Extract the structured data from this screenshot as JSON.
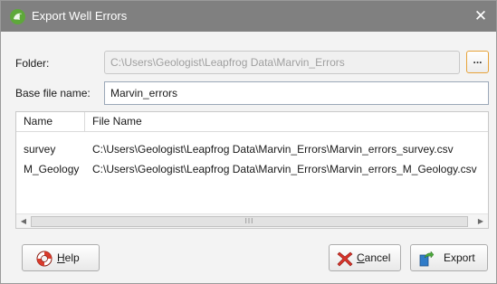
{
  "window": {
    "title": "Export Well Errors",
    "close_glyph": "✕",
    "app_icon": "leapfrog-app-icon"
  },
  "form": {
    "folder_label": "Folder:",
    "folder_value": "C:\\Users\\Geologist\\Leapfrog Data\\Marvin_Errors",
    "browse_label": "...",
    "base_label": "Base file name:",
    "base_value": "Marvin_errors"
  },
  "table": {
    "columns": [
      "Name",
      "File Name"
    ],
    "rows": [
      {
        "name": "survey",
        "file": "C:\\Users\\Geologist\\Leapfrog Data\\Marvin_Errors\\Marvin_errors_survey.csv"
      },
      {
        "name": "M_Geology",
        "file": "C:\\Users\\Geologist\\Leapfrog Data\\Marvin_Errors\\Marvin_errors_M_Geology.csv"
      }
    ],
    "scroll_left_glyph": "◀",
    "scroll_right_glyph": "▶",
    "scroll_thumb_grip": "III"
  },
  "buttons": {
    "help_mnemonic": "H",
    "help_rest": "elp",
    "cancel_mnemonic": "C",
    "cancel_rest": "ancel",
    "export_label": "Export"
  },
  "icons": {
    "help": "lifebuoy-icon",
    "cancel": "red-x-icon",
    "export": "export-arrow-icon"
  },
  "colors": {
    "titlebar": "#808080",
    "browse_border": "#e7a33a",
    "help_icon_red": "#d93a2b",
    "cancel_icon_red": "#d8332a",
    "export_icon_blue": "#2f7bc8",
    "export_arrow_green": "#4aa83a"
  }
}
